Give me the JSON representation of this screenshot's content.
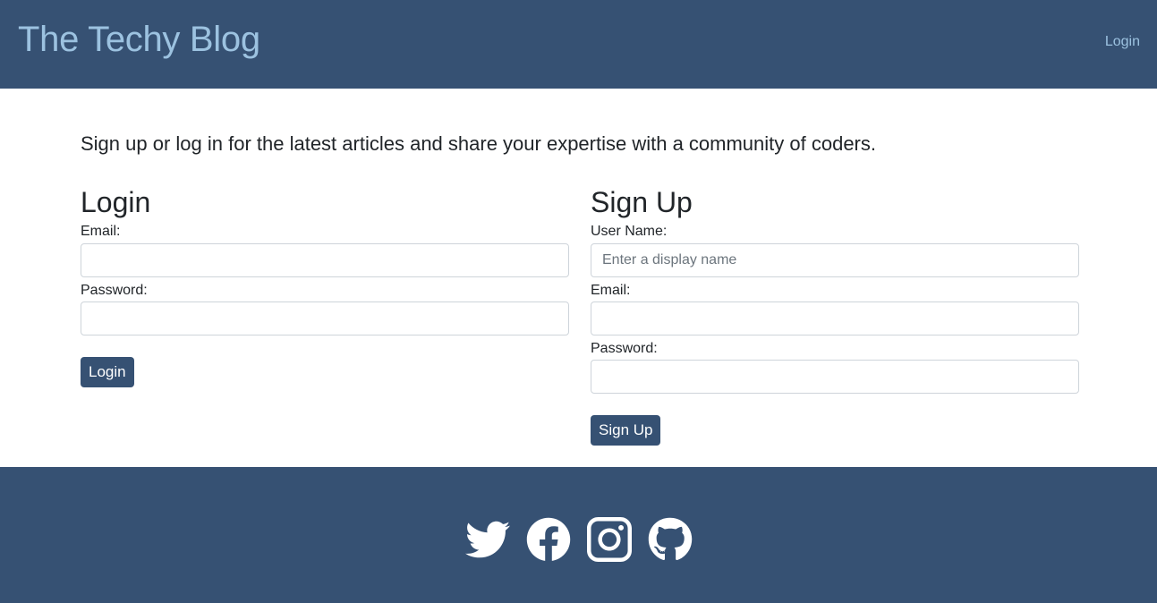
{
  "navbar": {
    "brand": "The Techy Blog",
    "login_link": "Login"
  },
  "intro": "Sign up or log in for the latest articles and share your expertise with a community of coders.",
  "login_form": {
    "heading": "Login",
    "email_label": "Email:",
    "email_value": "",
    "password_label": "Password:",
    "password_value": "",
    "submit_label": "Login"
  },
  "signup_form": {
    "heading": "Sign Up",
    "username_label": "User Name:",
    "username_placeholder": "Enter a display name",
    "email_label": "Email:",
    "password_label": "Password:",
    "submit_label": "Sign Up"
  },
  "footer": {
    "icons": [
      "twitter-icon",
      "facebook-icon",
      "instagram-icon",
      "github-icon"
    ]
  },
  "colors": {
    "primary": "#365173",
    "brand_text": "#9cc2e0",
    "text": "#212529"
  }
}
